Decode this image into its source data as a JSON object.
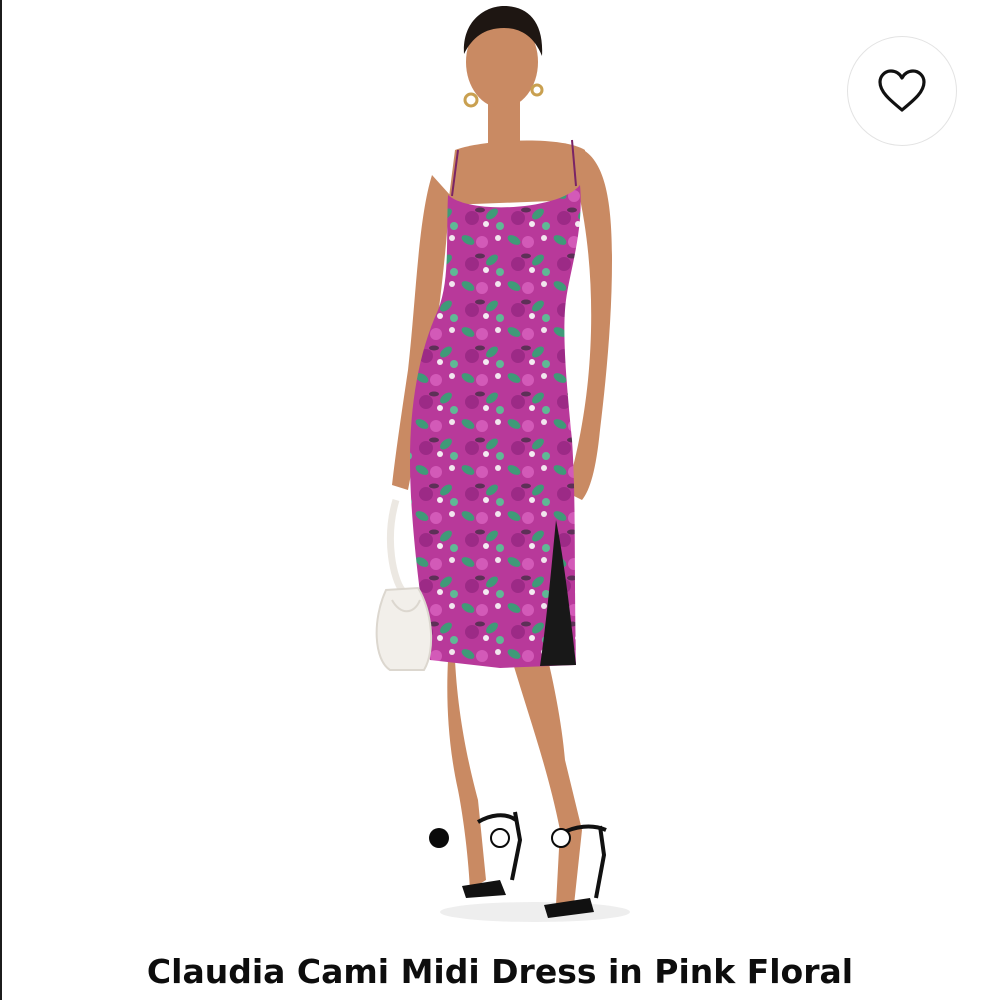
{
  "product": {
    "title": "Claudia Cami Midi Dress in Pink Floral",
    "image_alt": "Model wearing floral midi dress with white handbag and black heels"
  },
  "favorite": {
    "icon": "heart-outline-icon",
    "label": "Add to favorites"
  },
  "carousel": {
    "total": 3,
    "active_index": 0
  },
  "colors": {
    "dress_base": "#b8399a",
    "dress_leaf": "#3f9a78",
    "dot_active": "#0a0a0a",
    "skin": "#c98a63"
  }
}
